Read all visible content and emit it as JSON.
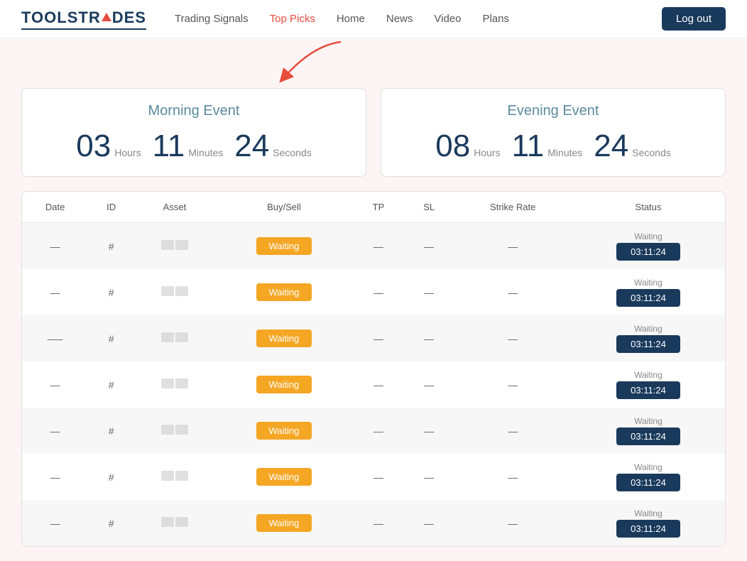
{
  "logo": {
    "text_left": "TOOLSTR",
    "text_right": "DES"
  },
  "nav": {
    "links": [
      {
        "label": "Trading Signals",
        "active": false
      },
      {
        "label": "Top Picks",
        "active": true
      },
      {
        "label": "Home",
        "active": false
      },
      {
        "label": "News",
        "active": false
      },
      {
        "label": "Video",
        "active": false
      },
      {
        "label": "Plans",
        "active": false
      }
    ],
    "logout_label": "Log out"
  },
  "morning_event": {
    "title": "Morning Event",
    "hours": "03",
    "hours_label": "Hours",
    "minutes": "11",
    "minutes_label": "Minutes",
    "seconds": "24",
    "seconds_label": "Seconds"
  },
  "evening_event": {
    "title": "Evening Event",
    "hours": "08",
    "hours_label": "Hours",
    "minutes": "11",
    "minutes_label": "Minutes",
    "seconds": "24",
    "seconds_label": "Seconds"
  },
  "table": {
    "headers": [
      "Date",
      "ID",
      "Asset",
      "Buy/Sell",
      "TP",
      "SL",
      "Strike Rate",
      "Status"
    ],
    "rows": [
      {
        "date": "—",
        "id": "#",
        "tp": "—",
        "sl": "—",
        "strike": "—",
        "waiting_label": "Waiting",
        "status_text": "Waiting",
        "status_time": "03:11:24"
      },
      {
        "date": "—",
        "id": "#",
        "tp": "—",
        "sl": "—",
        "strike": "—",
        "waiting_label": "Waiting",
        "status_text": "Waiting",
        "status_time": "03:11:24"
      },
      {
        "date": "—–",
        "id": "#",
        "tp": "—",
        "sl": "—",
        "strike": "—",
        "waiting_label": "Waiting",
        "status_text": "Waiting",
        "status_time": "03:11:24"
      },
      {
        "date": "—",
        "id": "#",
        "tp": "—",
        "sl": "—",
        "strike": "—",
        "waiting_label": "Waiting",
        "status_text": "Waiting",
        "status_time": "03:11:24"
      },
      {
        "date": "—",
        "id": "#",
        "tp": "—",
        "sl": "—",
        "strike": "—",
        "waiting_label": "Waiting",
        "status_text": "Waiting",
        "status_time": "03:11:24"
      },
      {
        "date": "—",
        "id": "#",
        "tp": "—",
        "sl": "—",
        "strike": "—",
        "waiting_label": "Waiting",
        "status_text": "Waiting",
        "status_time": "03:11:24"
      },
      {
        "date": "—",
        "id": "#",
        "tp": "—",
        "sl": "—",
        "strike": "—",
        "waiting_label": "Waiting",
        "status_text": "Waiting",
        "status_time": "03:11:24"
      }
    ]
  }
}
